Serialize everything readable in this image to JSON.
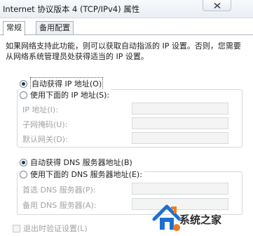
{
  "window": {
    "title": "Internet 协议版本 4 (TCP/IPv4) 属性",
    "close_icon": "close-x-icon"
  },
  "tabs": [
    {
      "label": "常规",
      "active": true
    },
    {
      "label": "备用配置",
      "active": false
    }
  ],
  "description": "如果网络支持此功能，则可以获取自动指派的 IP 设置。否则，您需要从网络系统管理员处获得适当的 IP 设置。",
  "ip_section": {
    "auto_option": {
      "label": "自动获得 IP 地址(O)",
      "selected": true
    },
    "manual_option": {
      "label": "使用下面的 IP 地址(S):",
      "selected": false
    },
    "fields": [
      {
        "label": "IP 地址(I):",
        "value": "",
        "enabled": false
      },
      {
        "label": "子网掩码(U):",
        "value": "",
        "enabled": false
      },
      {
        "label": "默认网关(D):",
        "value": "",
        "enabled": false
      }
    ]
  },
  "dns_section": {
    "auto_option": {
      "label": "自动获得 DNS 服务器地址(B)",
      "selected": true
    },
    "manual_option": {
      "label": "使用下面的 DNS 服务器地址(E):",
      "selected": false
    },
    "fields": [
      {
        "label": "首选 DNS 服务器(P):",
        "value": "",
        "enabled": false
      },
      {
        "label": "备用 DNS 服务器(A):",
        "value": "",
        "enabled": false
      }
    ]
  },
  "validate_on_exit": {
    "label": "退出时验证设置(L)",
    "checked": false,
    "enabled": false
  },
  "watermark": {
    "text": "系统之家",
    "logo_icon": "house-logo-icon"
  },
  "colors": {
    "watermark_blue": "#1f6fd1",
    "watermark_orange": "#f07b1c",
    "disabled_text": "#a3a3a3"
  }
}
